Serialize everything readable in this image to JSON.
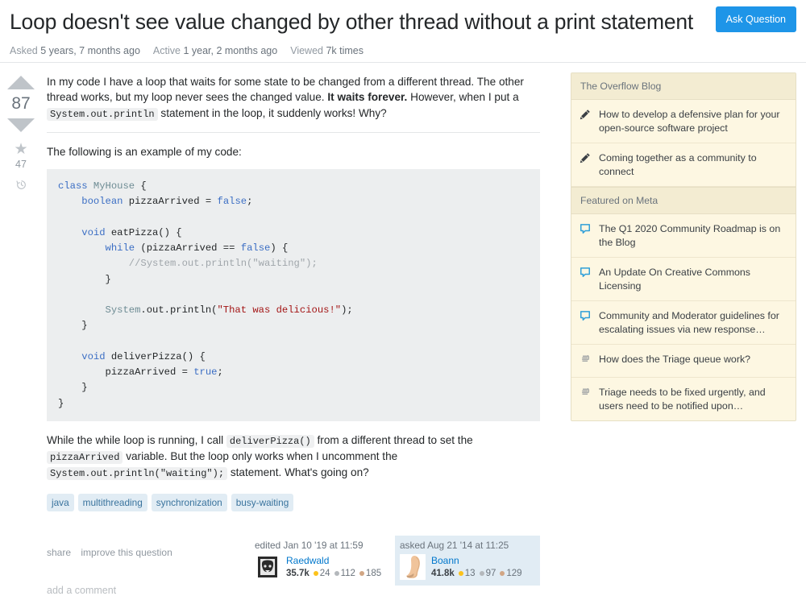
{
  "header": {
    "title": "Loop doesn't see value changed by other thread without a print statement",
    "ask_button": "Ask Question",
    "meta": {
      "asked_key": "Asked",
      "asked_value": "5 years, 7 months ago",
      "active_key": "Active",
      "active_value": "1 year, 2 months ago",
      "viewed_key": "Viewed",
      "viewed_value": "7k times"
    }
  },
  "vote": {
    "count": "87",
    "favorite_count": "47",
    "up_icon": "arrow-up-icon",
    "down_icon": "arrow-down-icon",
    "star_icon": "star-icon",
    "history_icon": "history-icon"
  },
  "post": {
    "para1_a": "In my code I have a loop that waits for some state to be changed from a different thread. The other thread works, but my loop never sees the changed value. ",
    "para1_bold": "It waits forever.",
    "para1_b": " However, when I put a ",
    "para1_code": "System.out.println",
    "para1_c": " statement in the loop, it suddenly works! Why?",
    "para2": "The following is an example of my code:",
    "code_lines": [
      {
        "class": "k",
        "text": "class "
      },
      {
        "class": "t",
        "text": "MyHouse"
      },
      {
        "class": "p",
        "text": " {"
      }
    ],
    "para3_a": "While the while loop is running, I call ",
    "para3_code1": "deliverPizza()",
    "para3_b": " from a different thread to set the ",
    "para3_code2": "pizzaArrived",
    "para3_c": " variable. But the loop only works when I uncomment the ",
    "para3_code3": "System.out.println(\"waiting\");",
    "para3_d": " statement. What's going on?",
    "tags": [
      "java",
      "multithreading",
      "synchronization",
      "busy-waiting"
    ],
    "share_label": "share",
    "improve_label": "improve this question",
    "add_comment_label": "add a comment"
  },
  "editor_card": {
    "action": "edited Jan 10 '19 at 11:59",
    "username": "Raedwald",
    "reputation": "35.7k",
    "gold": "24",
    "silver": "112",
    "bronze": "185"
  },
  "asker_card": {
    "action": "asked Aug 21 '14 at 11:25",
    "username": "Boann",
    "reputation": "41.8k",
    "gold": "13",
    "silver": "97",
    "bronze": "129"
  },
  "sidebar": {
    "sections": [
      {
        "header": "The Overflow Blog",
        "items": [
          {
            "icon": "pencil-icon",
            "text": "How to develop a defensive plan for your open-source software project"
          },
          {
            "icon": "pencil-icon",
            "text": "Coming together as a community to connect"
          }
        ]
      },
      {
        "header": "Featured on Meta",
        "items": [
          {
            "icon": "speech-bubble-icon",
            "text": "The Q1 2020 Community Roadmap is on the Blog"
          },
          {
            "icon": "speech-bubble-icon",
            "text": "An Update On Creative Commons Licensing"
          },
          {
            "icon": "speech-bubble-icon",
            "text": "Community and Moderator guidelines for escalating issues via new response…"
          },
          {
            "icon": "stack-icon",
            "text": "How does the Triage queue work?"
          },
          {
            "icon": "stack-icon",
            "text": "Triage needs to be fixed urgently, and users need to be notified upon…"
          }
        ]
      }
    ]
  },
  "colors": {
    "accent_blue": "#1e95e8",
    "link_blue": "#0077cc",
    "tag_bg": "#e1ecf4",
    "tag_text": "#39739d",
    "sidebar_bg": "#fdf7e2",
    "sidebar_header_bg": "#f3ecd2",
    "code_bg": "#eceeef",
    "gold_badge": "#fcc21b",
    "silver_badge": "#b4b8bc",
    "bronze_badge": "#d1a684"
  }
}
